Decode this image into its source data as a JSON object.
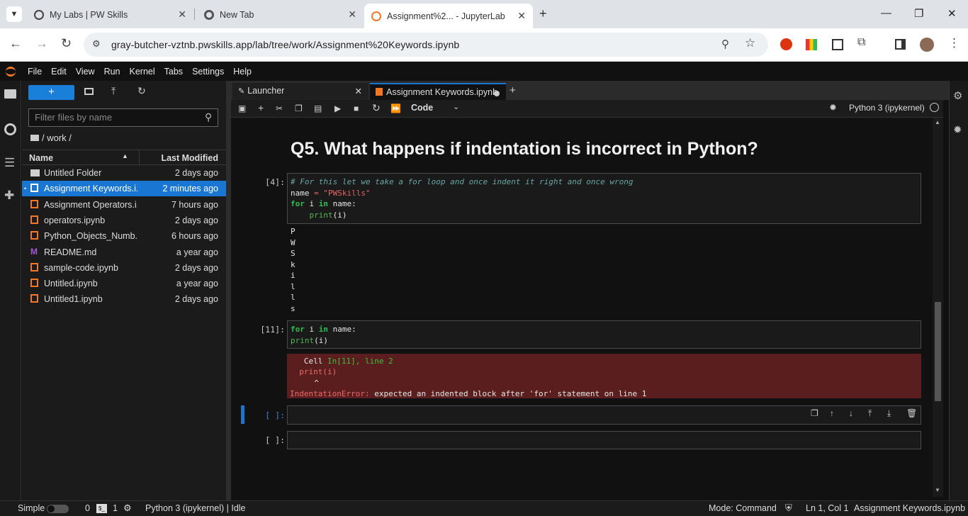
{
  "browser": {
    "tabs": [
      {
        "title": "My Labs | PW Skills",
        "icon": "wordpress-icon"
      },
      {
        "title": "New Tab",
        "icon": "chrome-icon"
      },
      {
        "title": "Assignment%2... - JupyterLab",
        "icon": "jupyter-icon",
        "active": true
      }
    ],
    "url": "gray-butcher-vztnb.pwskills.app/lab/tree/work/Assignment%20Keywords.ipynb"
  },
  "menu": [
    "File",
    "Edit",
    "View",
    "Run",
    "Kernel",
    "Tabs",
    "Settings",
    "Help"
  ],
  "filebrowser": {
    "new_label": "+",
    "filter_placeholder": "Filter files by name",
    "breadcrumb": "/ work /",
    "col_name": "Name",
    "col_modified": "Last Modified",
    "files": [
      {
        "name": "Untitled Folder",
        "modified": "2 days ago",
        "type": "folder"
      },
      {
        "name": "Assignment Keywords.i...",
        "modified": "2 minutes ago",
        "type": "notebook",
        "selected": true
      },
      {
        "name": "Assignment Operators.i...",
        "modified": "7 hours ago",
        "type": "notebook"
      },
      {
        "name": "operators.ipynb",
        "modified": "2 days ago",
        "type": "notebook"
      },
      {
        "name": "Python_Objects_Numb...",
        "modified": "6 hours ago",
        "type": "notebook"
      },
      {
        "name": "README.md",
        "modified": "a year ago",
        "type": "markdown"
      },
      {
        "name": "sample-code.ipynb",
        "modified": "2 days ago",
        "type": "notebook"
      },
      {
        "name": "Untitled.ipynb",
        "modified": "a year ago",
        "type": "notebook"
      },
      {
        "name": "Untitled1.ipynb",
        "modified": "2 days ago",
        "type": "notebook"
      }
    ]
  },
  "doc_tabs": [
    {
      "title": "Launcher"
    },
    {
      "title": "Assignment Keywords.ipynb",
      "active": true
    }
  ],
  "toolbar": {
    "cell_type": "Code",
    "kernel": "Python 3 (ipykernel)"
  },
  "notebook": {
    "heading": "Q5. What happens if indentation is incorrect in Python?",
    "cell4_prompt": "[4]:",
    "cell4_comment": "# For this let we take a for loop and once indent it right and once wrong",
    "cell4_output": [
      "P",
      "W",
      "S",
      "k",
      "i",
      "l",
      "l",
      "s"
    ],
    "cell11_prompt": "[11]:",
    "error_lines": {
      "l1_a": "Cell ",
      "l1_b": "In[11], line 2",
      "l2": "  print(i)",
      "l3": "  ^",
      "l4_a": "IndentationError:",
      "l4_b": " expected an indented block after 'for' statement on line 1"
    },
    "empty_prompt_1": "[ ]:",
    "empty_prompt_2": "[ ]:"
  },
  "status": {
    "mode_simple": "Simple",
    "terminals": "0",
    "kernels": "1",
    "kernel_status": "Python 3 (ipykernel) | Idle",
    "mode": "Mode: Command",
    "position": "Ln 1, Col 1",
    "filename": "Assignment Keywords.ipynb"
  },
  "colors": {
    "accent": "#1976d2",
    "error_bg": "#5a1e1e",
    "jupyter_orange": "#f37726"
  }
}
